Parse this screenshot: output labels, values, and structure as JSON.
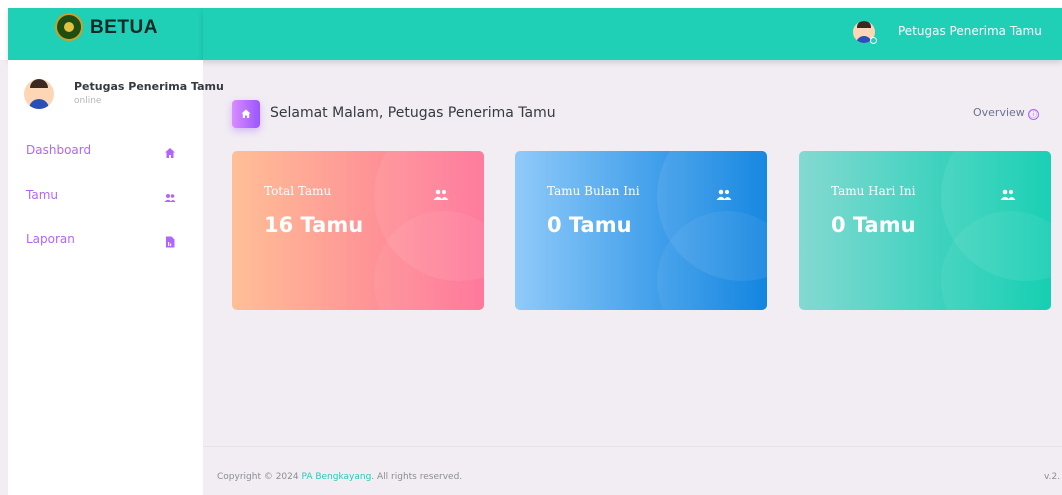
{
  "app": {
    "brand": "BETUA"
  },
  "navbar": {
    "user_name": "Petugas Penerima Tamu",
    "caret": "⌄"
  },
  "sidebar": {
    "profile": {
      "name": "Petugas Penerima Tamu",
      "status": "online"
    },
    "items": [
      {
        "label": "Dashboard",
        "icon": "home-icon"
      },
      {
        "label": "Tamu",
        "icon": "users-icon"
      },
      {
        "label": "Laporan",
        "icon": "report-icon"
      }
    ]
  },
  "header": {
    "greeting": "Selamat Malam, Petugas Penerima Tamu",
    "overview_label": "Overview",
    "overview_icon": "ⓘ"
  },
  "cards": [
    {
      "label": "Total Tamu",
      "value": "16 Tamu",
      "icon": "users-icon"
    },
    {
      "label": "Tamu Bulan Ini",
      "value": "0 Tamu",
      "icon": "users-icon"
    },
    {
      "label": "Tamu Hari Ini",
      "value": "0 Tamu",
      "icon": "users-icon"
    }
  ],
  "footer": {
    "prefix": "Copyright © 2024 ",
    "link": "PA Bengkayang",
    "suffix": ". All rights reserved.",
    "version": "v.2."
  },
  "colors": {
    "accent": "#1fcfb6",
    "menu": "#b066fe",
    "card1": [
      "#ffbf96",
      "#fe7096"
    ],
    "card2": [
      "#90caf9",
      "#047edf"
    ],
    "card3": [
      "#84d9d2",
      "#07cdae"
    ]
  }
}
